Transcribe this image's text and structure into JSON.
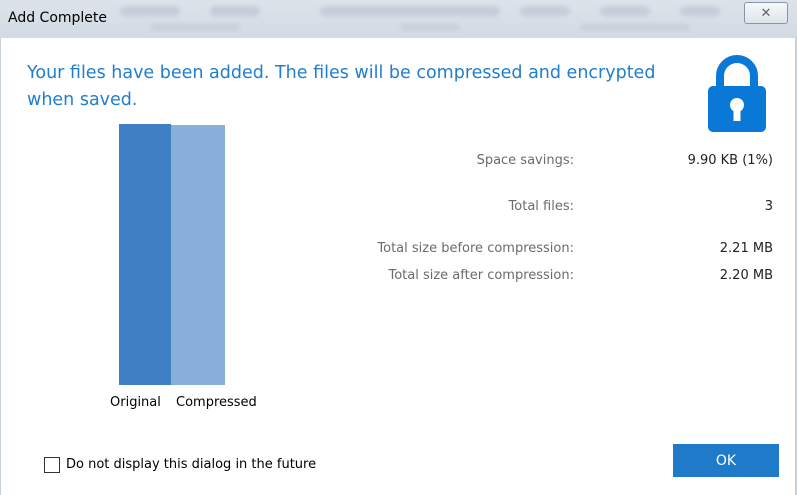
{
  "window": {
    "title": "Add Complete",
    "close_glyph": "✕"
  },
  "headline": "Your files have been added.  The files will be compressed and encrypted when saved.",
  "icon": {
    "name": "lock-icon",
    "color": "#0a78d6"
  },
  "chart_data": {
    "type": "bar",
    "categories": [
      "Original",
      "Compressed"
    ],
    "values": [
      2.21,
      2.2
    ],
    "colors": [
      "#3f7fc3",
      "#88aed9"
    ],
    "title": "",
    "xlabel": "",
    "ylabel": ""
  },
  "stats": [
    {
      "label": "Space savings:",
      "value": "9.90 KB (1%)"
    },
    {
      "label": "Total files:",
      "value": "3"
    },
    {
      "label": "Total size before compression:",
      "value": "2.21 MB"
    },
    {
      "label": "Total size after compression:",
      "value": "2.20 MB"
    }
  ],
  "footer": {
    "checkbox_label": "Do not display this dialog in the future",
    "checkbox_checked": false,
    "ok_label": "OK"
  },
  "colors": {
    "accent": "#1f7bc9",
    "headline": "#1f7ed0"
  }
}
